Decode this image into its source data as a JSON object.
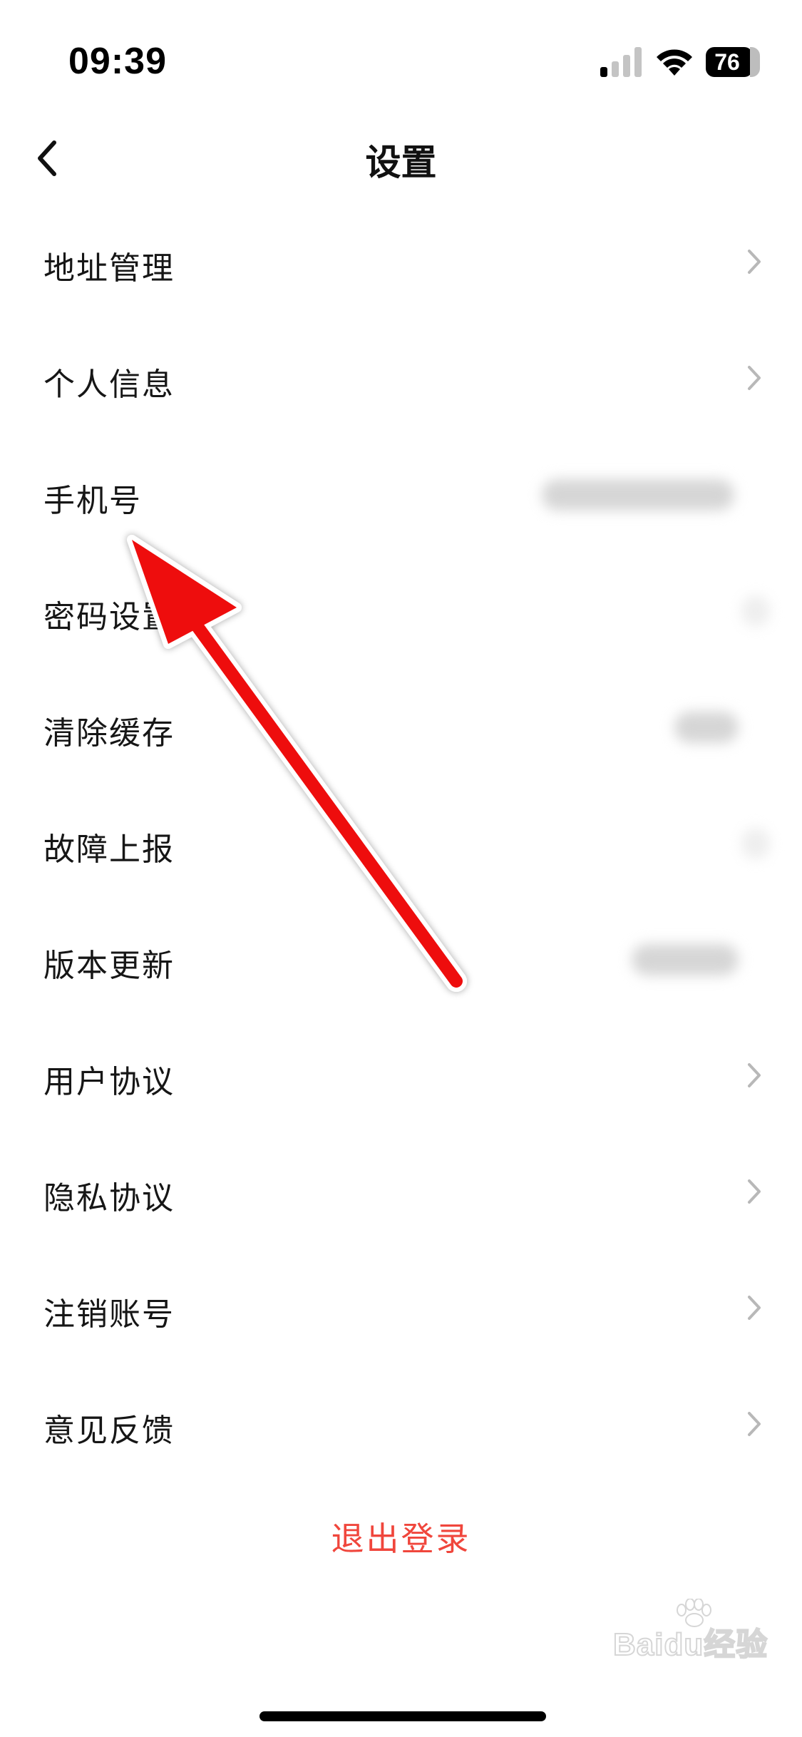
{
  "status_bar": {
    "time": "09:39",
    "battery": "76"
  },
  "nav": {
    "title": "设置"
  },
  "settings": {
    "items": [
      {
        "label": "地址管理",
        "trailing": "chevron"
      },
      {
        "label": "个人信息",
        "trailing": "chevron"
      },
      {
        "label": "手机号",
        "trailing": "blurred-value"
      },
      {
        "label": "密码设置",
        "trailing": "blurred-value"
      },
      {
        "label": "清除缓存",
        "trailing": "blurred-value"
      },
      {
        "label": "故障上报",
        "trailing": "blurred-value"
      },
      {
        "label": "版本更新",
        "trailing": "blurred-value"
      },
      {
        "label": "用户协议",
        "trailing": "chevron"
      },
      {
        "label": "隐私协议",
        "trailing": "chevron"
      },
      {
        "label": "注销账号",
        "trailing": "chevron"
      },
      {
        "label": "意见反馈",
        "trailing": "chevron"
      }
    ],
    "logout_label": "退出登录"
  },
  "watermark": {
    "text": "Baidu经验"
  },
  "colors": {
    "logout": "#f0463c",
    "annotation_arrow": "#ee1111",
    "chevron": "#b8b8b8"
  }
}
